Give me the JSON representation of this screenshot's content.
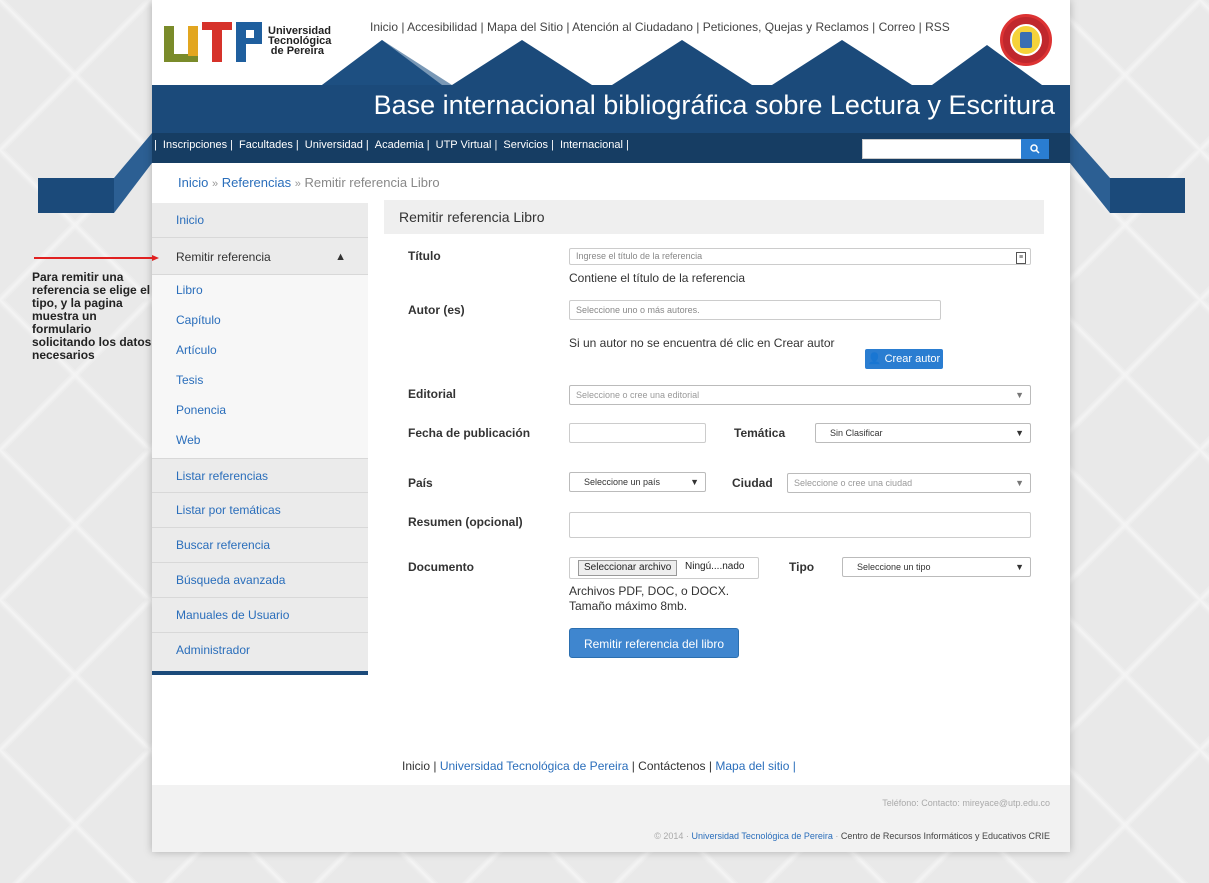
{
  "header": {
    "logo_text_lines": [
      "Universidad",
      "Tecnológica",
      "de Pereira"
    ],
    "top_links": [
      "Inicio",
      "Accesibilidad",
      "Mapa del Sitio",
      "Atención al Ciudadano",
      "Peticiones, Quejas y Reclamos",
      "Correo",
      "RSS"
    ],
    "banner_title": "Base internacional bibliográfica sobre Lectura y Escritura"
  },
  "nav": {
    "items": [
      "Inscripciones",
      "Facultades",
      "Universidad",
      "Academia",
      "UTP Virtual",
      "Servicios",
      "Internacional"
    ],
    "search_placeholder": "",
    "search_icon": "search-icon"
  },
  "breadcrumb": {
    "items": [
      "Inicio",
      "Referencias",
      "Remitir referencia Libro"
    ],
    "separator": "»"
  },
  "sidebar": {
    "items": [
      "Inicio",
      "Remitir referencia"
    ],
    "sub_items": [
      "Libro",
      "Capítulo",
      "Artículo",
      "Tesis",
      "Ponencia",
      "Web"
    ],
    "items_after": [
      "Listar referencias",
      "Listar por temáticas",
      "Buscar referencia",
      "Búsqueda avanzada",
      "Manuales de Usuario",
      "Administrador"
    ]
  },
  "form": {
    "title": "Remitir referencia Libro",
    "titulo_label": "Título",
    "titulo_placeholder": "Ingrese el título de la referencia",
    "titulo_help": "Contiene el título de la referencia",
    "autor_label": "Autor (es)",
    "autor_placeholder": "Seleccione uno o más autores.",
    "autor_help": "Si un autor no se encuentra dé clic en Crear autor",
    "crear_autor": "Crear autor",
    "editorial_label": "Editorial",
    "editorial_placeholder": "Seleccione o cree una editorial",
    "fecha_label": "Fecha de publicación",
    "fecha_value": "",
    "tematica_label": "Temática",
    "tematica_value": "Sin Clasificar",
    "pais_label": "País",
    "pais_value": "Seleccione un país",
    "ciudad_label": "Ciudad",
    "ciudad_placeholder": "Seleccione o cree una ciudad",
    "resumen_label": "Resumen (opcional)",
    "resumen_value": "",
    "documento_label": "Documento",
    "file_button": "Seleccionar archivo",
    "file_name": "Ningú....nado",
    "tipo_label": "Tipo",
    "tipo_value": "Seleccione un tipo",
    "doc_help_1": "Archivos PDF, DOC, o DOCX.",
    "doc_help_2": "Tamaño máximo 8mb.",
    "submit": "Remitir referencia del libro"
  },
  "footer": {
    "links": [
      "Inicio",
      "Universidad Tecnológica de Pereira",
      "Contáctenos",
      "Mapa del sitio"
    ],
    "phone": "Teléfono: Contacto: mireyace@utp.edu.co",
    "copy_prefix": "© 2014 ·",
    "copy_link": "Universidad Tecnológica de Pereira",
    "copy_mid": "·",
    "copy_suffix": "Centro de Recursos Informáticos y Educativos CRIE"
  },
  "annotation": {
    "text": "Para remitir una referencia se elige el tipo, y la pagina muestra un formulario solicitando los datos necesarios"
  },
  "colors": {
    "brand_blue": "#1b4a7a",
    "link_blue": "#2a6ebb",
    "button_blue": "#3f86cf",
    "arrow_red": "#e02020"
  }
}
